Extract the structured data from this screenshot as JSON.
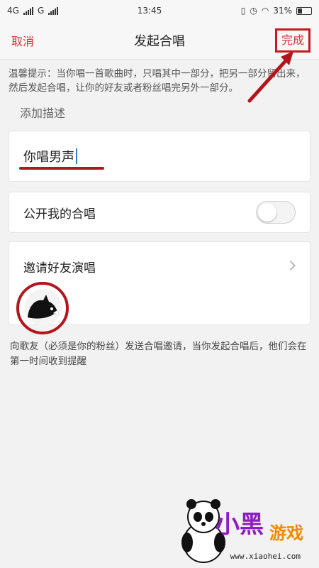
{
  "status_bar": {
    "network1": "4G",
    "network2": "G",
    "time": "13:45",
    "battery": "31%"
  },
  "navbar": {
    "cancel": "取消",
    "title": "发起合唱",
    "done": "完成"
  },
  "hint": "温馨提示：当你唱一首歌曲时，只唱其中一部分，把另一部分留出来，然后发起合唱，让你的好友或者粉丝唱完另外一部分。",
  "description": {
    "label": "添加描述",
    "value": "你唱男声"
  },
  "public_toggle": {
    "label": "公开我的合唱",
    "on": false
  },
  "invite": {
    "label": "邀请好友演唱"
  },
  "footer_note": "向歌友（必须是你的粉丝）发送合唱邀请，当你发起合唱后，他们会在第一时间收到提醒",
  "watermark": {
    "brand_cn_1": "小黑",
    "brand_cn_2": "游戏",
    "url": "www.xiaohei.com"
  },
  "colors": {
    "accent": "#d9353a",
    "annotation": "#b3151c"
  }
}
